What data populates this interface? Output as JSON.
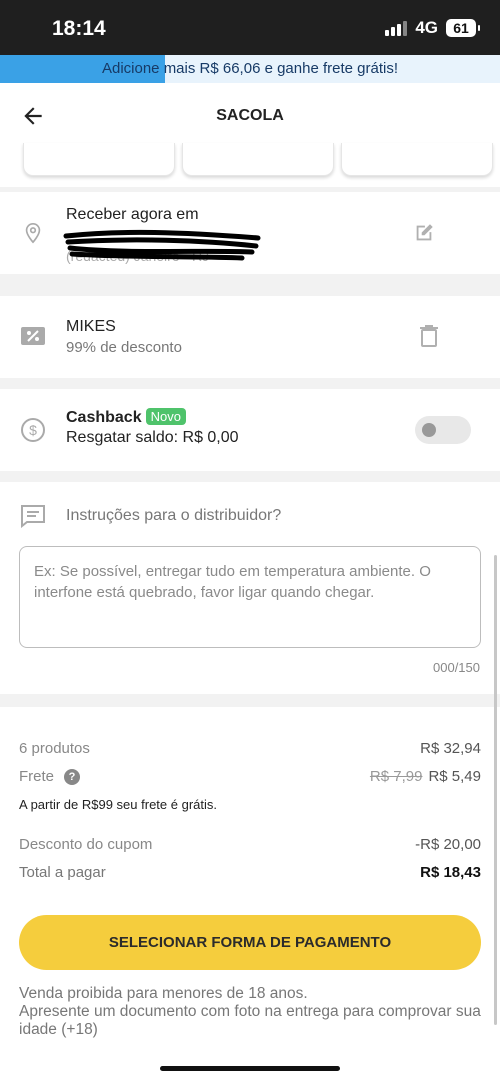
{
  "status_bar": {
    "time": "18:14",
    "network": "4G",
    "battery": "61"
  },
  "promo": {
    "text": "Adicione mais R$ 66,06 e ganhe frete grátis!",
    "progress_fraction": 0.33
  },
  "header": {
    "title": "SACOLA",
    "back_icon": "arrow-left-icon"
  },
  "address": {
    "title": "Receber agora em",
    "line_partial": "(redacted)    Janeiro - RJ"
  },
  "coupon": {
    "code": "MIKES",
    "description": "99% de desconto"
  },
  "cashback": {
    "title": "Cashback",
    "badge": "Novo",
    "balance_text": "Resgatar saldo: R$ 0,00",
    "enabled": false
  },
  "instructions": {
    "title": "Instruções para o distribuidor?",
    "placeholder": "Ex: Se possível, entregar tudo em temperatura ambiente. O interfone está quebrado, favor ligar quando chegar.",
    "counter": "000/150"
  },
  "summary": {
    "products_label": "6 produtos",
    "products_value": "R$ 32,94",
    "freight_label": "Frete",
    "freight_old": "R$ 7,99",
    "freight_value": "R$ 5,49",
    "free_shipping_note": "A partir de R$99 seu frete é grátis.",
    "coupon_discount_label": "Desconto do cupom",
    "coupon_discount_value": "-R$ 20,00",
    "total_label": "Total a pagar",
    "total_value": "R$ 18,43"
  },
  "pay_button": "SELECIONAR FORMA DE PAGAMENTO",
  "legal": {
    "line1": "Venda proibida para menores de 18 anos.",
    "line2": "Apresente um documento com foto na entrega para comprovar sua idade (+18)"
  }
}
